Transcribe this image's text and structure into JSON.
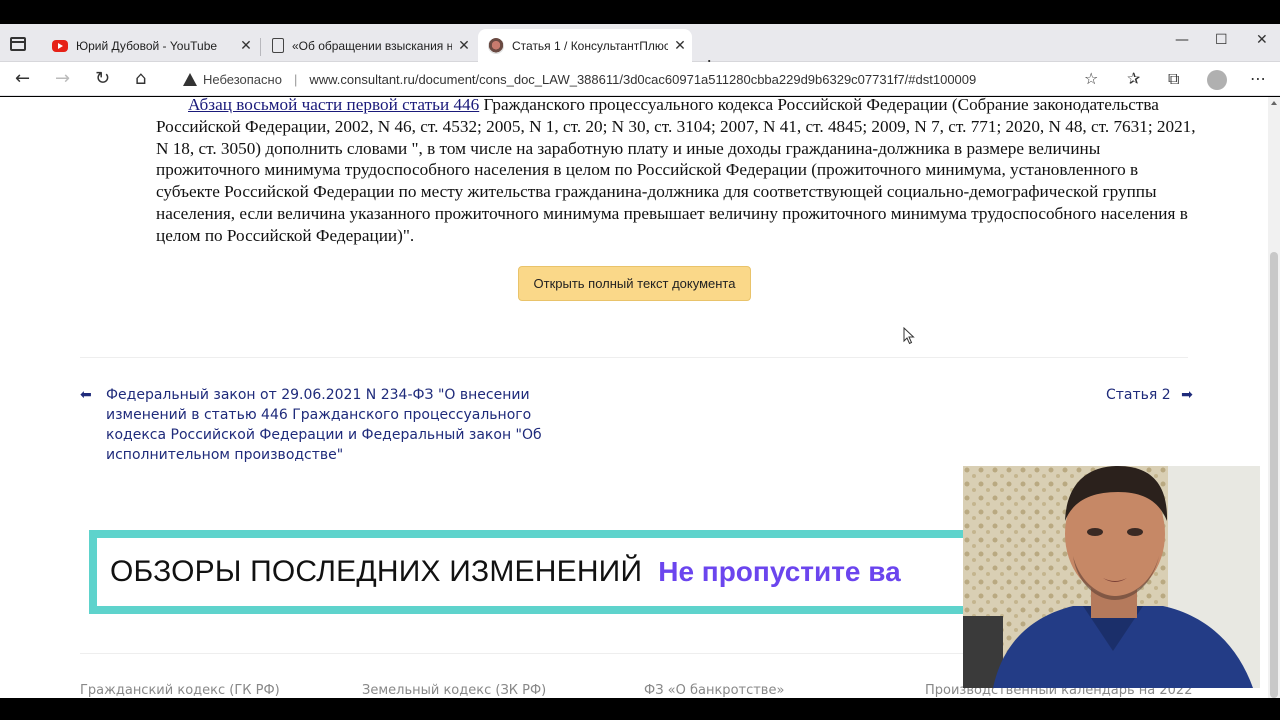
{
  "browser": {
    "tabs": [
      {
        "title": "Юрий Дубовой - YouTube",
        "icon": "youtube-icon",
        "active": false
      },
      {
        "title": "«Об обращении взыскания на",
        "icon": "document-icon",
        "active": false
      },
      {
        "title": "Статья 1 / КонсультантПлюс",
        "icon": "consultant-icon",
        "active": true
      }
    ],
    "security_label": "Небезопасно",
    "url": "www.consultant.ru/document/cons_doc_LAW_388611/3d0cac60971a511280cbba229d9b6329c07731f7/#dst100009"
  },
  "article": {
    "link_text": "Абзац восьмой части первой статьи 446",
    "body_text": " Гражданского процессуального кодекса Российской Федерации (Собрание законодательства Российской Федерации, 2002, N 46, ст. 4532; 2005, N 1, ст. 20; N 30, ст. 3104; 2007, N 41, ст. 4845; 2009, N 7, ст. 771; 2020, N 48, ст. 7631; 2021, N 18, ст. 3050) дополнить словами \", в том числе на заработную плату и иные доходы гражданина-должника в размере величины прожиточного минимума трудоспособного населения в целом по Российской Федерации (прожиточного минимума, установленного в субъекте Российской Федерации по месту жительства гражданина-должника для соответствующей социально-демографической группы населения, если величина указанного прожиточного минимума превышает величину прожиточного минимума трудоспособного населения в целом по Российской Федерации)\".",
    "open_full_label": "Открыть полный текст документа"
  },
  "navigation": {
    "prev_text": "Федеральный закон от 29.06.2021 N 234-ФЗ \"О внесении изменений в статью 446 Гражданского процессуального кодекса Российской Федерации и Федеральный закон \"Об исполнительном производстве\"",
    "next_text": "Статья 2"
  },
  "banner": {
    "main_text": "ОБЗОРЫ ПОСЛЕДНИХ ИЗМЕНЕНИЙ",
    "accent_text": "Не пропустите ва"
  },
  "footer": {
    "links": [
      "Гражданский кодекс (ГК РФ)",
      "Земельный кодекс (ЗК РФ)",
      "ФЗ «О банкротстве»",
      "Производственный календарь на 2022"
    ]
  },
  "colors": {
    "link": "#1f2b7b",
    "button_bg": "#fad889",
    "banner_border": "#5ed3cc",
    "banner_accent": "#6b45ee"
  }
}
